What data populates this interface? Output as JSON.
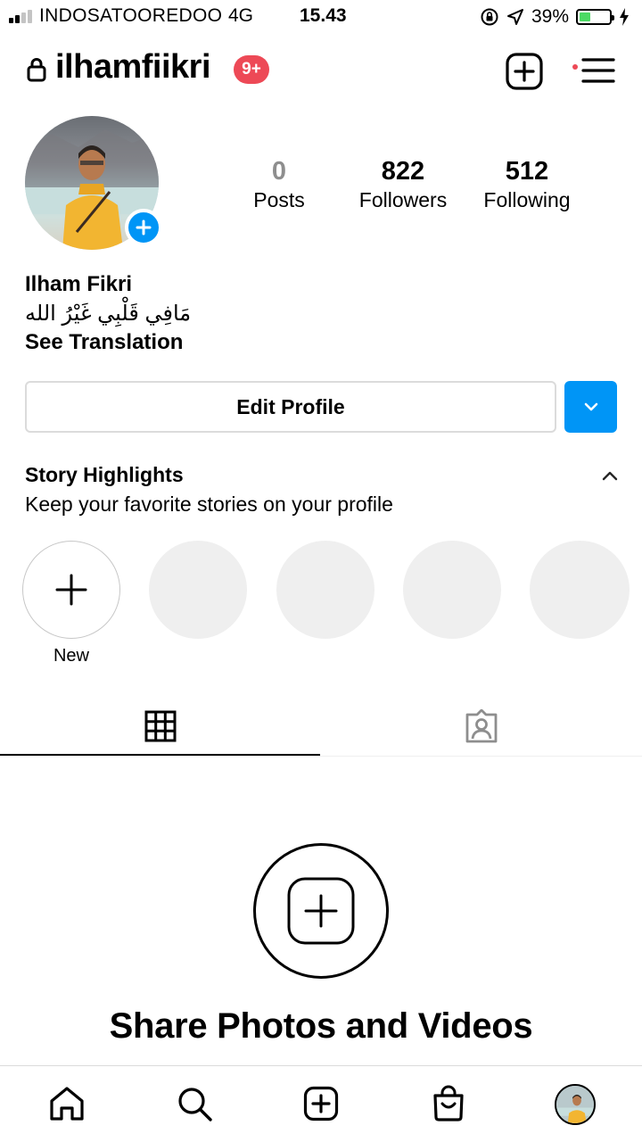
{
  "status_bar": {
    "carrier": "INDOSATOOREDOO",
    "network": "4G",
    "time": "15.43",
    "battery_percent": "39%",
    "battery_level": 0.39,
    "battery_color": "#4cd964"
  },
  "header": {
    "username": "ilhamfiikri",
    "notification_badge": "9+",
    "badge_color": "#ed4956"
  },
  "profile": {
    "stats": [
      {
        "value": "0",
        "label": "Posts"
      },
      {
        "value": "822",
        "label": "Followers"
      },
      {
        "value": "512",
        "label": "Following"
      }
    ],
    "full_name": "Ilham Fikri",
    "bio": "مَافِي قَلْبِي غَيْرُ الله",
    "see_translation": "See Translation",
    "edit_profile_label": "Edit Profile",
    "accent_color": "#0095f6"
  },
  "highlights": {
    "title": "Story Highlights",
    "subtitle": "Keep your favorite stories on your profile",
    "new_label": "New"
  },
  "tabs": [
    {
      "icon": "grid-icon",
      "active": true
    },
    {
      "icon": "tagged-person-icon",
      "active": false
    }
  ],
  "empty_state": {
    "title": "Share Photos and Videos"
  },
  "bottom_nav": [
    {
      "icon": "home-icon"
    },
    {
      "icon": "search-icon"
    },
    {
      "icon": "add-post-icon"
    },
    {
      "icon": "shop-bag-icon"
    },
    {
      "icon": "profile-avatar"
    }
  ]
}
